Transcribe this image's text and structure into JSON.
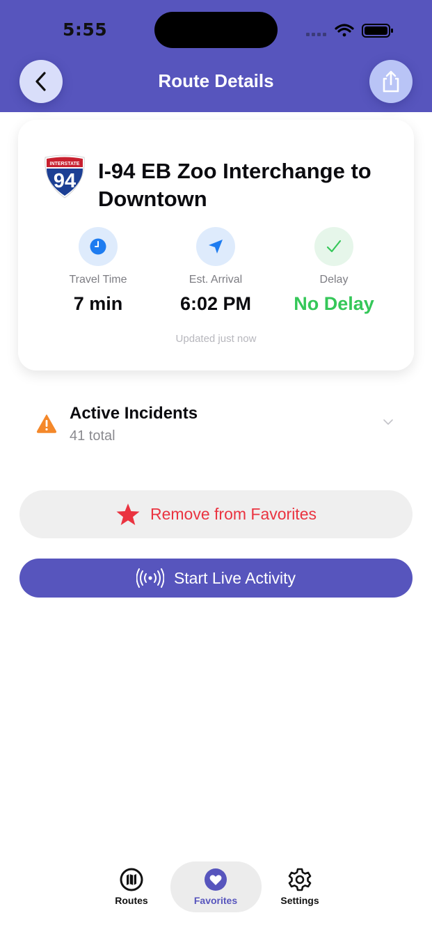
{
  "status_bar": {
    "time": "5:55"
  },
  "header": {
    "title": "Route Details"
  },
  "colors": {
    "brand": "#5755bd",
    "delay_ok": "#35c759",
    "favorite_red": "#ea3340",
    "warning": "#f4882a",
    "clock_blue": "#1e7cf0"
  },
  "route": {
    "shield": {
      "top_text": "INTERSTATE",
      "number": "94"
    },
    "title": "I-94 EB Zoo Interchange to Downtown",
    "stats": [
      {
        "icon": "clock-icon",
        "label": "Travel Time",
        "value": "7 min"
      },
      {
        "icon": "location-arrow-icon",
        "label": "Est. Arrival",
        "value": "6:02 PM"
      },
      {
        "icon": "checkmark-icon",
        "label": "Delay",
        "value": "No Delay"
      }
    ],
    "updated": "Updated just now"
  },
  "incidents": {
    "title": "Active Incidents",
    "subtitle": "41 total",
    "icon": "warning-triangle-icon"
  },
  "actions": {
    "favorite_label": "Remove from Favorites",
    "live_activity_label": "Start Live Activity"
  },
  "tabs": [
    {
      "label": "Routes",
      "icon": "map-icon",
      "active": false
    },
    {
      "label": "Favorites",
      "icon": "heart-icon",
      "active": true
    },
    {
      "label": "Settings",
      "icon": "gear-icon",
      "active": false
    }
  ]
}
